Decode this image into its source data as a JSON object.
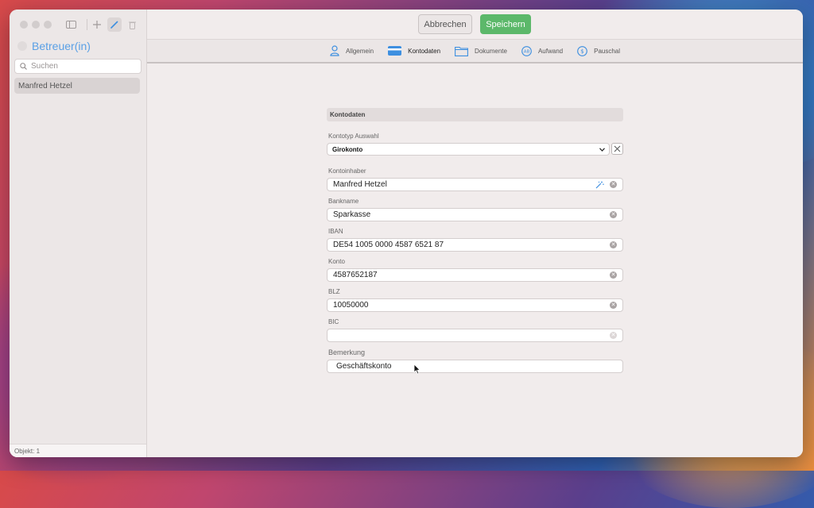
{
  "sidebar": {
    "title": "Betreuer(in)",
    "search_placeholder": "Suchen",
    "items": [
      {
        "label": "Manfred Hetzel"
      }
    ],
    "footer": "Objekt: 1"
  },
  "toolbar": {
    "cancel_label": "Abbrechen",
    "save_label": "Speichern",
    "save_color": "#5cb86a"
  },
  "tabs": [
    {
      "label": "Allgemein",
      "icon": "person-icon"
    },
    {
      "label": "Kontodaten",
      "icon": "credit-card-icon",
      "active": true
    },
    {
      "label": "Dokumente",
      "icon": "folder-icon"
    },
    {
      "label": "Aufwand",
      "icon": "ab-circle-icon"
    },
    {
      "label": "Pauschal",
      "icon": "dollar-circle-icon"
    }
  ],
  "form": {
    "section_title": "Kontodaten",
    "kontotyp": {
      "label": "Kontotyp Auswahl",
      "value": "Girokonto"
    },
    "kontoinhaber": {
      "label": "Kontoinhaber",
      "value": "Manfred Hetzel"
    },
    "bankname": {
      "label": "Bankname",
      "value": "Sparkasse"
    },
    "iban": {
      "label": "IBAN",
      "value": "DE54 1005 0000 4587 6521 87"
    },
    "konto": {
      "label": "Konto",
      "value": "4587652187"
    },
    "blz": {
      "label": "BLZ",
      "value": "10050000"
    },
    "bic": {
      "label": "BIC",
      "value": ""
    },
    "bemerkung": {
      "label": "Bemerkung",
      "value": "Geschäftskonto"
    }
  },
  "accent_color": "#3d8fe0"
}
